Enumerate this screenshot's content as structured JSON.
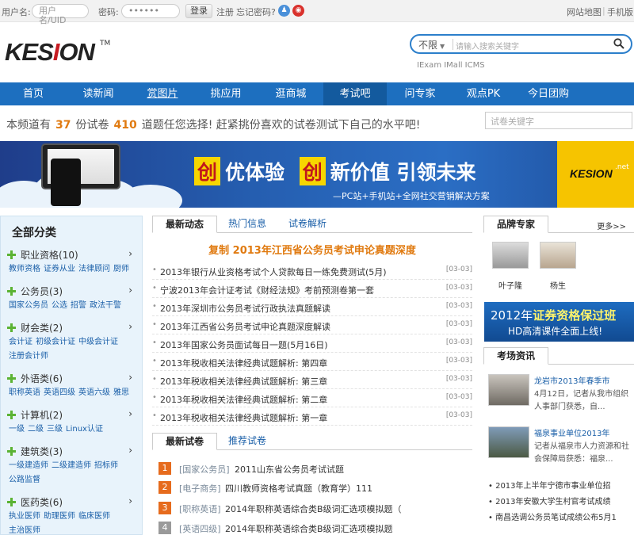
{
  "topbar": {
    "username_label": "用户名:",
    "username_placeholder": "用户名/UID",
    "password_label": "密码:",
    "password_mask": "••••••",
    "login": "登录",
    "register": "注册",
    "forgot": "忘记密码?",
    "sitemap": "网站地图",
    "sep": "|",
    "mobile": "手机版"
  },
  "logo": {
    "text_pre": "KES",
    "text_o": "I",
    "text_post": "ON",
    "tm": "TM"
  },
  "search": {
    "scope": "不限",
    "placeholder": "请输入搜索关键字",
    "sublinks": "IExam IMall ICMS"
  },
  "nav": [
    "首页",
    "读新闻",
    "赏图片",
    "挑应用",
    "逛商城",
    "考试吧",
    "问专家",
    "观点PK",
    "今日团购"
  ],
  "intro": {
    "pre": "本频道有",
    "papers": "37",
    "mid": "份试卷",
    "questions": "410",
    "post": "道题任您选择! 赶紧挑份喜欢的试卷测试下自己的水平吧!",
    "search_placeholder": "试卷关键字"
  },
  "banner": {
    "w1": "创",
    "t1": "优体验",
    "w2": "创",
    "t2": "新价值  引领未来",
    "slogan": "—PC站+手机站+全网社交营销解决方案",
    "brand": "KESION",
    "net": ".net"
  },
  "categories": {
    "title": "全部分类",
    "items": [
      {
        "name": "职业资格",
        "count": "(10)",
        "subs": [
          "教师资格",
          "证券从业",
          "法律顾问",
          "厨师"
        ]
      },
      {
        "name": "公务员",
        "count": "(3)",
        "subs": [
          "国家公务员",
          "公选",
          "招警",
          "政法干警"
        ]
      },
      {
        "name": "财会类",
        "count": "(2)",
        "subs": [
          "会计证",
          "初级会计证",
          "中级会计证",
          "注册会计师"
        ]
      },
      {
        "name": "外语类",
        "count": "(6)",
        "subs": [
          "职称英语",
          "英语四级",
          "英语六级",
          "雅思"
        ]
      },
      {
        "name": "计算机",
        "count": "(2)",
        "subs": [
          "一级",
          "二级",
          "三级",
          "Linux认证"
        ]
      },
      {
        "name": "建筑类",
        "count": "(3)",
        "subs": [
          "一级建造师",
          "二级建造师",
          "招标师",
          "公路监督"
        ]
      },
      {
        "name": "医药类",
        "count": "(6)",
        "subs": [
          "执业医师",
          "助理医师",
          "临床医师",
          "主治医师"
        ]
      }
    ],
    "arrow": "›"
  },
  "news_tabs": [
    "最新动态",
    "热门信息",
    "试卷解析"
  ],
  "news_headline": "复制  2013年江西省公务员考试申论真题深度",
  "news": [
    {
      "title": "2013年银行从业资格考试个人贷款每日一练免费测试(5月)",
      "date": "[03-03]"
    },
    {
      "title": "宁波2013年会计证考试《财经法规》考前预测卷第一套",
      "date": "[03-03]"
    },
    {
      "title": "2013年深圳市公务员考试行政执法真题解读",
      "date": "[03-03]"
    },
    {
      "title": "2013年江西省公务员考试申论真题深度解读",
      "date": "[03-03]"
    },
    {
      "title": "2013年国家公务员面试每日一题(5月16日)",
      "date": "[03-03]"
    },
    {
      "title": "2013年税收相关法律经典试题解析: 第四章",
      "date": "[03-03]"
    },
    {
      "title": "2013年税收相关法律经典试题解析: 第三章",
      "date": "[03-03]"
    },
    {
      "title": "2013年税收相关法律经典试题解析: 第二章",
      "date": "[03-03]"
    },
    {
      "title": "2013年税收相关法律经典试题解析: 第一章",
      "date": "[03-03]"
    }
  ],
  "exam_tabs": [
    "最新试卷",
    "推荐试卷"
  ],
  "exams": [
    {
      "n": "1",
      "cat": "[国家公务员]",
      "title": "2011山东省公务员考试试题"
    },
    {
      "n": "2",
      "cat": "[电子商务]",
      "title": "四川教师资格考试真题（教育学）111"
    },
    {
      "n": "3",
      "cat": "[职称英语]",
      "title": "2014年职称英语综合类B级词汇选项模拟题（"
    },
    {
      "n": "4",
      "cat": "[英语四级]",
      "title": "2014年职称英语综合类B级词汇选项模拟题"
    }
  ],
  "experts": {
    "tab": "品牌专家",
    "more": "更多>>",
    "people": [
      "叶子隆",
      "杨生"
    ]
  },
  "ad": {
    "l1_pre": "2012年",
    "l1_bold": "证券资格保过班",
    "l2": "HD高清课件全面上线!"
  },
  "exam_info": {
    "tab": "考场资讯",
    "items": [
      {
        "title": "龙岩市2013年春季市",
        "desc": "4月12日，记者从我市组织人事部门获悉，自..."
      },
      {
        "title": "福泉事业单位2013年",
        "desc": "记者从福泉市人力资源和社会保障局获悉：福泉..."
      }
    ],
    "list": [
      "2013年上半年宁德市事业单位招",
      "2013年安徽大学生村官考试成绩",
      "南昌选调公务员笔试成绩公布5月1"
    ]
  },
  "colors": {
    "nav": "#1d6fbf",
    "accent": "#e07a10",
    "link": "#1a5fa8"
  }
}
